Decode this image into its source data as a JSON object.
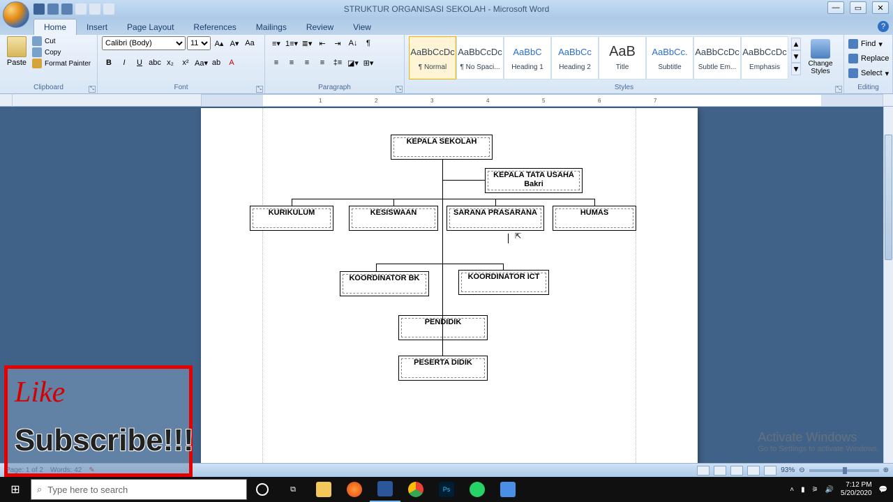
{
  "title": "STRUKTUR ORGANISASI SEKOLAH - Microsoft Word",
  "tabs": [
    "Home",
    "Insert",
    "Page Layout",
    "References",
    "Mailings",
    "Review",
    "View"
  ],
  "active_tab": "Home",
  "clipboard": {
    "paste": "Paste",
    "cut": "Cut",
    "copy": "Copy",
    "fmt": "Format Painter",
    "label": "Clipboard"
  },
  "font": {
    "name": "Calibri (Body)",
    "size": "11",
    "label": "Font"
  },
  "paragraph": {
    "label": "Paragraph"
  },
  "styles": {
    "label": "Styles",
    "items": [
      {
        "samp": "AaBbCcDc",
        "name": "¶ Normal",
        "cls": ""
      },
      {
        "samp": "AaBbCcDc",
        "name": "¶ No Spaci...",
        "cls": ""
      },
      {
        "samp": "AaBbC",
        "name": "Heading 1",
        "cls": "blue"
      },
      {
        "samp": "AaBbCc",
        "name": "Heading 2",
        "cls": "blue"
      },
      {
        "samp": "AaB",
        "name": "Title",
        "cls": "big"
      },
      {
        "samp": "AaBbCc.",
        "name": "Subtitle",
        "cls": "blue"
      },
      {
        "samp": "AaBbCcDc",
        "name": "Subtle Em...",
        "cls": ""
      },
      {
        "samp": "AaBbCcDc",
        "name": "Emphasis",
        "cls": ""
      }
    ],
    "change": "Change Styles"
  },
  "editing": {
    "find": "Find",
    "replace": "Replace",
    "select": "Select",
    "label": "Editing"
  },
  "ruler_marks": [
    "1",
    "2",
    "3",
    "4",
    "5",
    "6",
    "7"
  ],
  "chart_data": {
    "type": "table",
    "title": "Struktur Organisasi Sekolah",
    "nodes": [
      {
        "id": "kepala",
        "label": "KEPALA SEKOLAH",
        "parent": null
      },
      {
        "id": "tu",
        "label": "KEPALA TATA USAHA",
        "sub": "Bakri",
        "parent": "kepala"
      },
      {
        "id": "kurikulum",
        "label": "KURIKULUM",
        "parent": "kepala"
      },
      {
        "id": "kesiswaan",
        "label": "KESISWAAN",
        "parent": "kepala"
      },
      {
        "id": "sarana",
        "label": "SARANA PRASARANA",
        "parent": "kepala"
      },
      {
        "id": "humas",
        "label": "HUMAS",
        "parent": "kepala"
      },
      {
        "id": "bk",
        "label": "KOORDINATOR BK",
        "parent": "kepala"
      },
      {
        "id": "ict",
        "label": "KOORDINATOR ICT",
        "parent": "kepala"
      },
      {
        "id": "pendidik",
        "label": "PENDIDIK",
        "parent": "kepala"
      },
      {
        "id": "peserta",
        "label": "PESERTA DIDIK",
        "parent": "pendidik"
      }
    ]
  },
  "org": {
    "kepala": "KEPALA SEKOLAH",
    "tu_line1": "KEPALA TATA USAHA",
    "tu_line2": "Bakri",
    "kurikulum": "KURIKULUM",
    "kesiswaan": "KESISWAAN",
    "sarana": "SARANA PRASARANA",
    "humas": "HUMAS",
    "bk": "KOORDINATOR BK",
    "ict": "KOORDINATOR ICT",
    "pendidik": "PENDIDIK",
    "peserta": "PESERTA DIDIK"
  },
  "status": {
    "page": "Page: 1 of 2",
    "words": "Words: 42",
    "zoom": "93%"
  },
  "overlay": {
    "like": "Like",
    "subscribe": "Subscribe!!!"
  },
  "activate": {
    "h": "Activate Windows",
    "s": "Go to Settings to activate Windows."
  },
  "search_placeholder": "Type here to search",
  "clock": {
    "time": "7:12 PM",
    "date": "5/20/2020"
  }
}
